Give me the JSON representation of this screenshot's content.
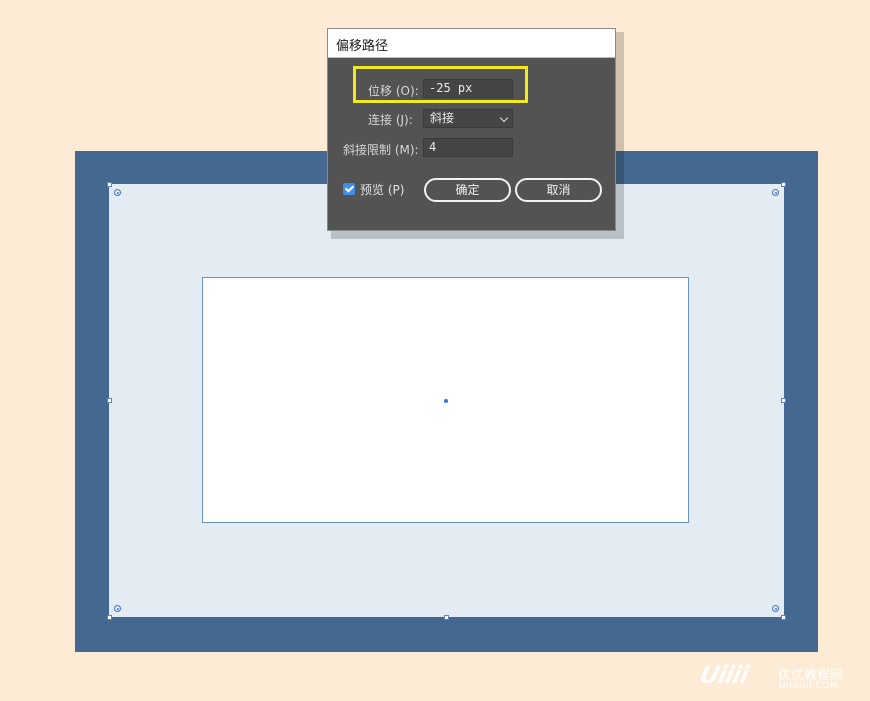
{
  "dialog": {
    "title": "偏移路径",
    "offset_label": "位移 (O):",
    "offset_value": "-25 px",
    "join_label": "连接 (J):",
    "join_value": "斜接",
    "miter_label": "斜接限制 (M):",
    "miter_value": "4",
    "preview_label": "预览 (P)",
    "preview_checked": true,
    "ok_label": "确定",
    "cancel_label": "取消"
  },
  "colors": {
    "background": "#fdebd6",
    "outer_frame": "#44688f",
    "inner_panel": "#e3ebf3",
    "selection": "#3f73d8",
    "highlight": "#f2ea1c",
    "dialog_bg": "#535353"
  },
  "watermark": {
    "logo": "Uiiii",
    "site_name": "优优教程网",
    "url": "UIIIUIII.COM"
  }
}
